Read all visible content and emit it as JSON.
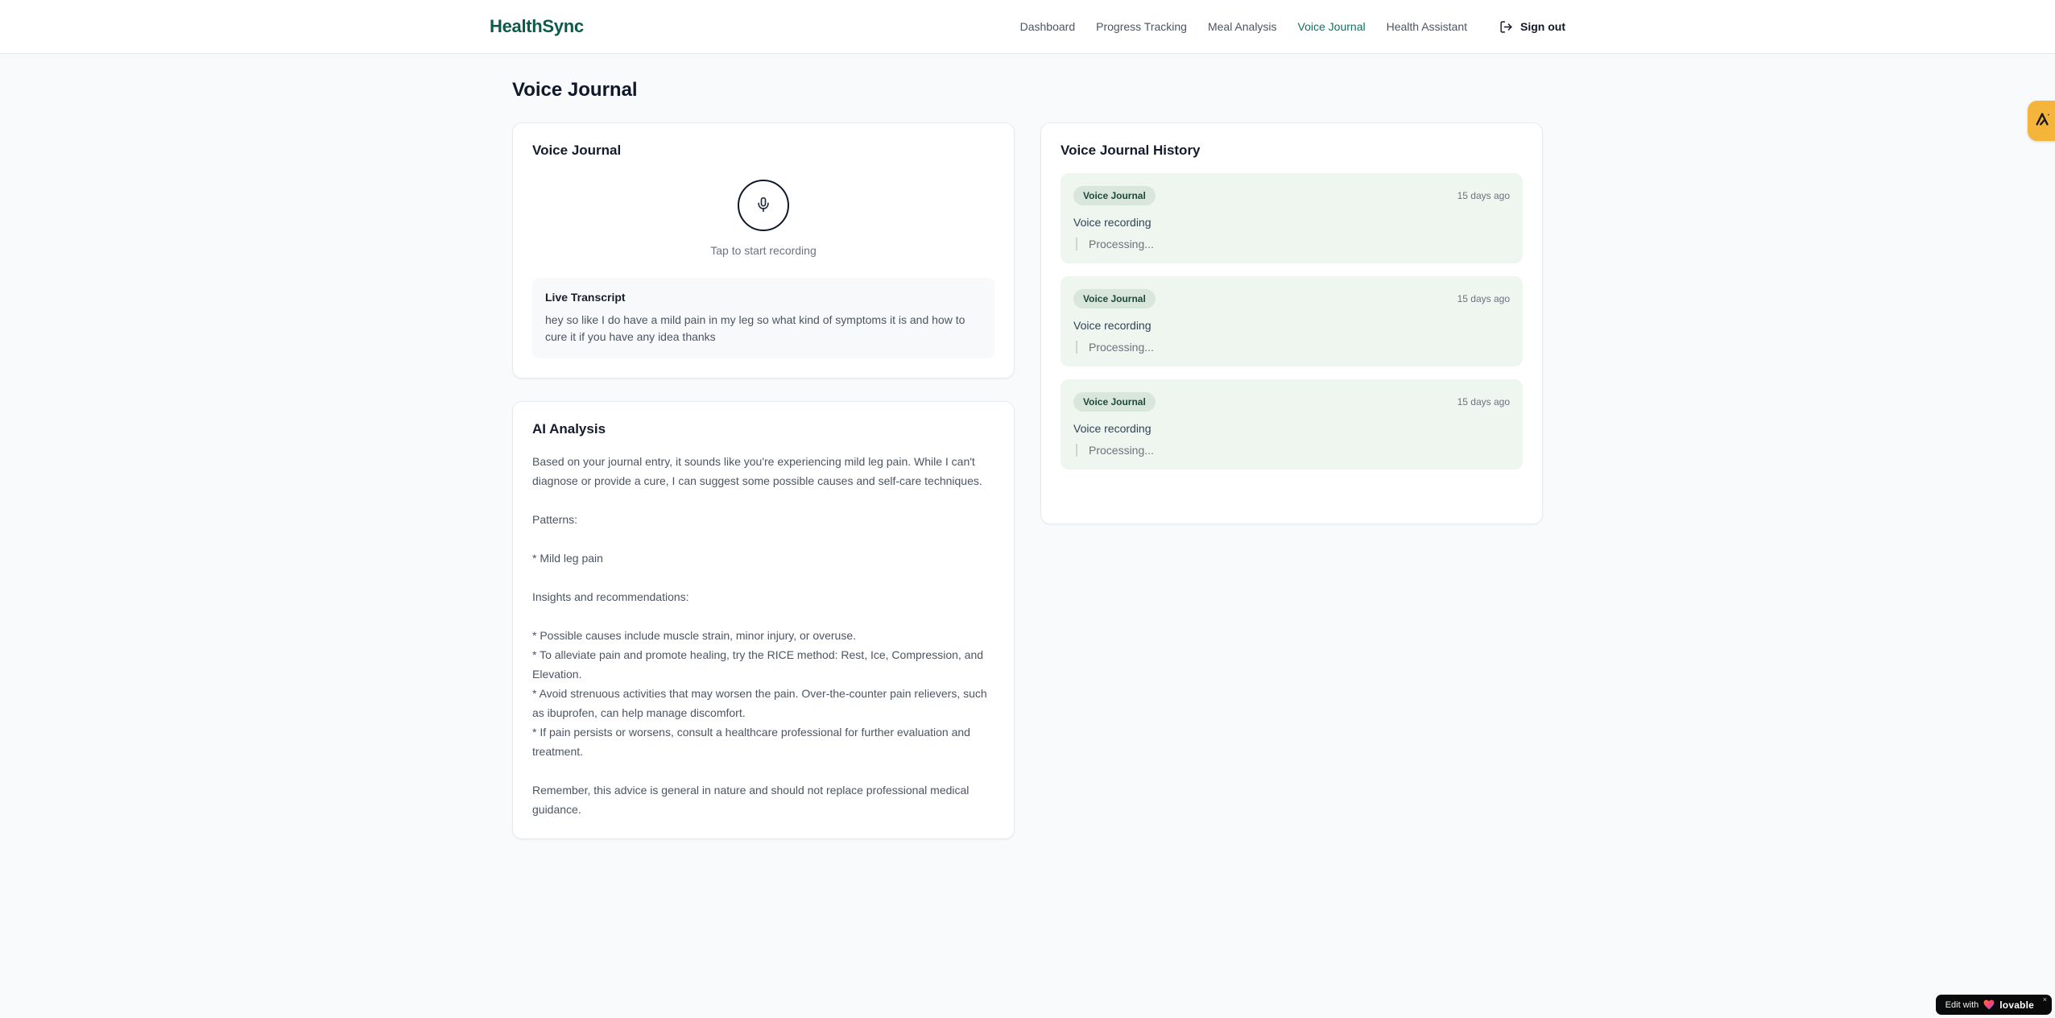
{
  "brand": {
    "name": "HealthSync"
  },
  "nav": {
    "items": [
      {
        "label": "Dashboard"
      },
      {
        "label": "Progress Tracking"
      },
      {
        "label": "Meal Analysis"
      },
      {
        "label": "Voice Journal"
      },
      {
        "label": "Health Assistant"
      }
    ],
    "active_item": "Voice Journal",
    "sign_out_label": "Sign out"
  },
  "page": {
    "title": "Voice Journal"
  },
  "recorder": {
    "card_title": "Voice Journal",
    "mic_icon": "microphone-icon",
    "tap_hint": "Tap to start recording",
    "transcript_title": "Live Transcript",
    "transcript_text": "hey so like I do have a mild pain in my leg so what kind of symptoms it is and how to cure it if you have any idea thanks"
  },
  "analysis": {
    "card_title": "AI Analysis",
    "body": "Based on your journal entry, it sounds like you're experiencing mild leg pain. While I can't diagnose or provide a cure, I can suggest some possible causes and self-care techniques.\n\nPatterns:\n\n* Mild leg pain\n\nInsights and recommendations:\n\n* Possible causes include muscle strain, minor injury, or overuse.\n* To alleviate pain and promote healing, try the RICE method: Rest, Ice, Compression, and Elevation.\n* Avoid strenuous activities that may worsen the pain. Over-the-counter pain relievers, such as ibuprofen, can help manage discomfort.\n* If pain persists or worsens, consult a healthcare professional for further evaluation and treatment.\n\nRemember, this advice is general in nature and should not replace professional medical guidance."
  },
  "history": {
    "card_title": "Voice Journal History",
    "entries": [
      {
        "badge": "Voice Journal",
        "time": "15 days ago",
        "title": "Voice recording",
        "status": "Processing..."
      },
      {
        "badge": "Voice Journal",
        "time": "15 days ago",
        "title": "Voice recording",
        "status": "Processing..."
      },
      {
        "badge": "Voice Journal",
        "time": "15 days ago",
        "title": "Voice recording",
        "status": "Processing..."
      }
    ]
  },
  "widgets": {
    "side_tab_icon": "lovable-logo-icon",
    "edit_label": "Edit with",
    "heart_icon": "gradient-heart-icon",
    "lovable_brand": "lovable",
    "close_label": "×"
  },
  "colors": {
    "brand_green": "#0b5a4b",
    "active_nav": "#0d7263",
    "entry_bg": "#eef6ef",
    "badge_bg": "#d8e6dc",
    "badge_text": "#1d4a3a",
    "amber_tab": "#f5b53a",
    "page_bg": "#f8fafc"
  }
}
